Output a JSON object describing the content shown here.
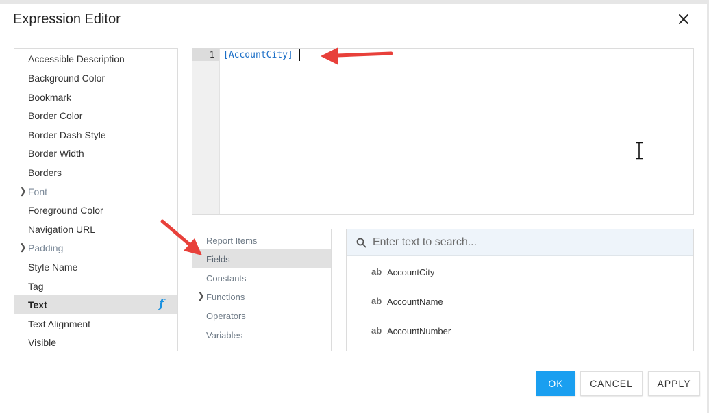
{
  "dialog": {
    "title": "Expression Editor"
  },
  "properties": [
    {
      "label": "Accessible Description"
    },
    {
      "label": "Background Color"
    },
    {
      "label": "Bookmark"
    },
    {
      "label": "Border Color"
    },
    {
      "label": "Border Dash Style"
    },
    {
      "label": "Border Width"
    },
    {
      "label": "Borders"
    },
    {
      "label": "Font"
    },
    {
      "label": "Foreground Color"
    },
    {
      "label": "Navigation URL"
    },
    {
      "label": "Padding"
    },
    {
      "label": "Style Name"
    },
    {
      "label": "Tag"
    },
    {
      "label": "Text",
      "fx": "f"
    },
    {
      "label": "Text Alignment"
    },
    {
      "label": "Visible"
    }
  ],
  "editor": {
    "line_number": "1",
    "code": "[AccountCity]"
  },
  "categories": [
    {
      "label": "Report Items"
    },
    {
      "label": "Fields"
    },
    {
      "label": "Constants"
    },
    {
      "label": "Functions"
    },
    {
      "label": "Operators"
    },
    {
      "label": "Variables"
    }
  ],
  "search": {
    "placeholder": "Enter text to search..."
  },
  "fields": [
    {
      "badge": "ab",
      "name": "AccountCity"
    },
    {
      "badge": "ab",
      "name": "AccountName"
    },
    {
      "badge": "ab",
      "name": "AccountNumber"
    }
  ],
  "buttons": {
    "ok": "OK",
    "cancel": "CANCEL",
    "apply": "APPLY"
  },
  "colors": {
    "accent": "#1a9ff0",
    "annotation_arrow": "#e8403a",
    "code_text": "#1c6fc7",
    "selected_row": "#e1e1e1"
  }
}
